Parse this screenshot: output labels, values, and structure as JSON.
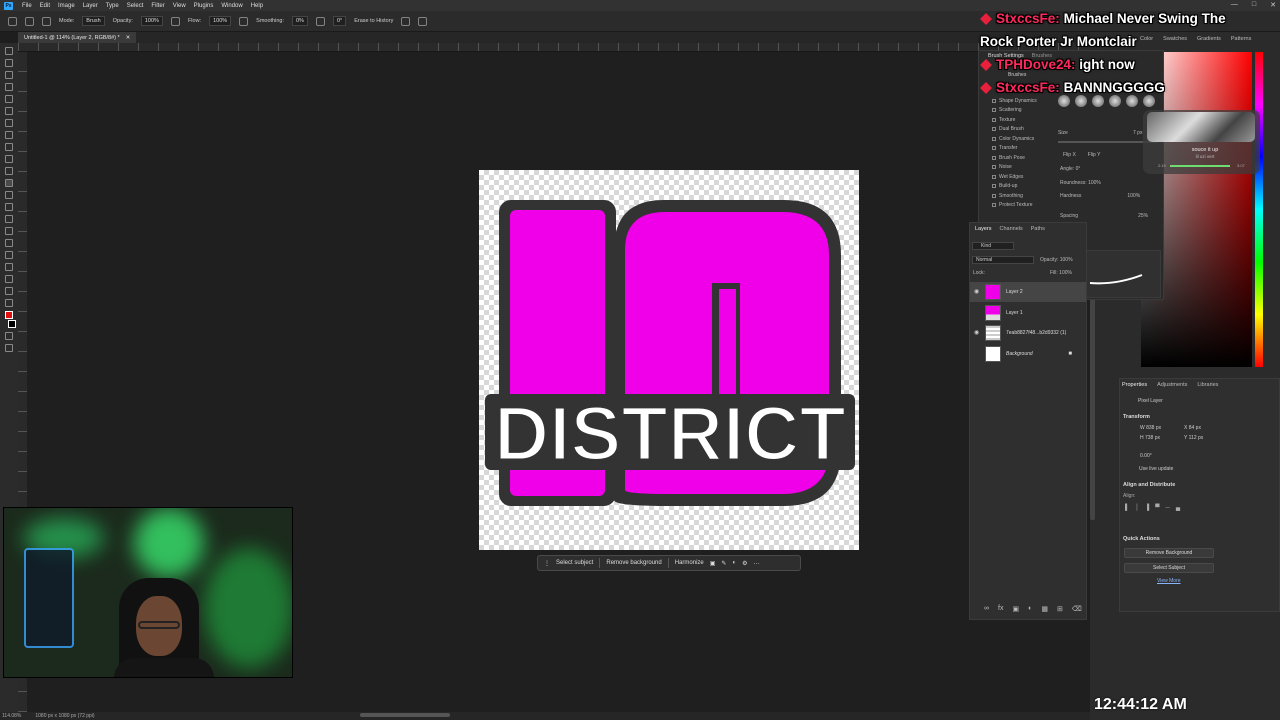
{
  "menu": [
    "File",
    "Edit",
    "Image",
    "Layer",
    "Type",
    "Select",
    "Filter",
    "View",
    "Plugins",
    "Window",
    "Help"
  ],
  "options_bar": {
    "mode_label": "Mode:",
    "mode_value": "Brush",
    "opacity_label": "Opacity:",
    "opacity_value": "100%",
    "flow_label": "Flow:",
    "flow_value": "100%",
    "smoothing_label": "Smoothing:",
    "smoothing_value": "0%",
    "angle_value": "0°",
    "erase_history": "Erase to History"
  },
  "document_tab": "Untitled-1 @ 114% (Layer 2, RGB/8#) *",
  "artwork": {
    "big_text": "10",
    "word": "DISTRICT",
    "colors": {
      "magenta": "#f000e8",
      "outline": "#333333",
      "white": "#ffffff"
    }
  },
  "context_bar": {
    "select_subject": "Select subject",
    "remove_background": "Remove background",
    "harmonize": "Harmonize"
  },
  "status": {
    "zoom": "114.08%",
    "doc_size": "1080 px x 1080 px (72 ppi)"
  },
  "panel_tabs_top": [
    "Color",
    "Swatches",
    "Gradients",
    "Patterns"
  ],
  "brush_settings": {
    "title": "Brush Settings",
    "tab2": "Brushes",
    "brushes_label": "Brushes",
    "items": [
      "Shape Dynamics",
      "Scattering",
      "Texture",
      "Dual Brush",
      "Color Dynamics",
      "Transfer",
      "Brush Pose",
      "Noise",
      "Wet Edges",
      "Build-up",
      "Smoothing",
      "Protect Texture"
    ],
    "size_label": "Size",
    "flip_x": "Flip X",
    "flip_y": "Flip Y",
    "angle": "Angle:  0°",
    "roundness": "Roundness:  100%",
    "hardness": "Hardness",
    "hardness_value": "100%",
    "spacing": "Spacing",
    "spacing_value": "25%",
    "size_value": "7 px"
  },
  "layers": {
    "tabs": [
      "Layers",
      "Channels",
      "Paths"
    ],
    "kind": "Kind",
    "mode": "Normal",
    "opacity": "Opacity: 100%",
    "lock": "Lock:",
    "fill": "Fill: 100%",
    "rows": [
      {
        "name": "Layer 2"
      },
      {
        "name": "Layer 1"
      },
      {
        "name": "7eab8827f48...b2d9332 (1)"
      },
      {
        "name": "Background"
      }
    ]
  },
  "properties": {
    "tabs": [
      "Properties",
      "Adjustments",
      "Libraries"
    ],
    "pixel_layer": "Pixel Layer",
    "transform": "Transform",
    "w": "W  838 px",
    "x": "X  84 px",
    "h": "H  738 px",
    "y": "Y  112 px",
    "angle": "0.00°",
    "live_update": "Use live update",
    "align_title": "Align and Distribute",
    "align_sub": "Align:",
    "qa_title": "Quick Actions",
    "qa_remove": "Remove Background",
    "qa_select": "Select Subject",
    "view_more": "View More"
  },
  "chat": [
    {
      "user": "StxccsFe:",
      "msg": "Michael Never Swing The"
    },
    {
      "user": "",
      "msg": "Rock Porter Jr Montclair"
    },
    {
      "user": "TPHDove24:",
      "msg": "ight now"
    },
    {
      "user": "StxccsFe:",
      "msg": "BANNNGGGGG"
    }
  ],
  "media": {
    "title": "souce it up",
    "sub": "lil uzi vert",
    "t0": "2:19",
    "t1": "3:07"
  },
  "clock": "12:44:12 AM"
}
